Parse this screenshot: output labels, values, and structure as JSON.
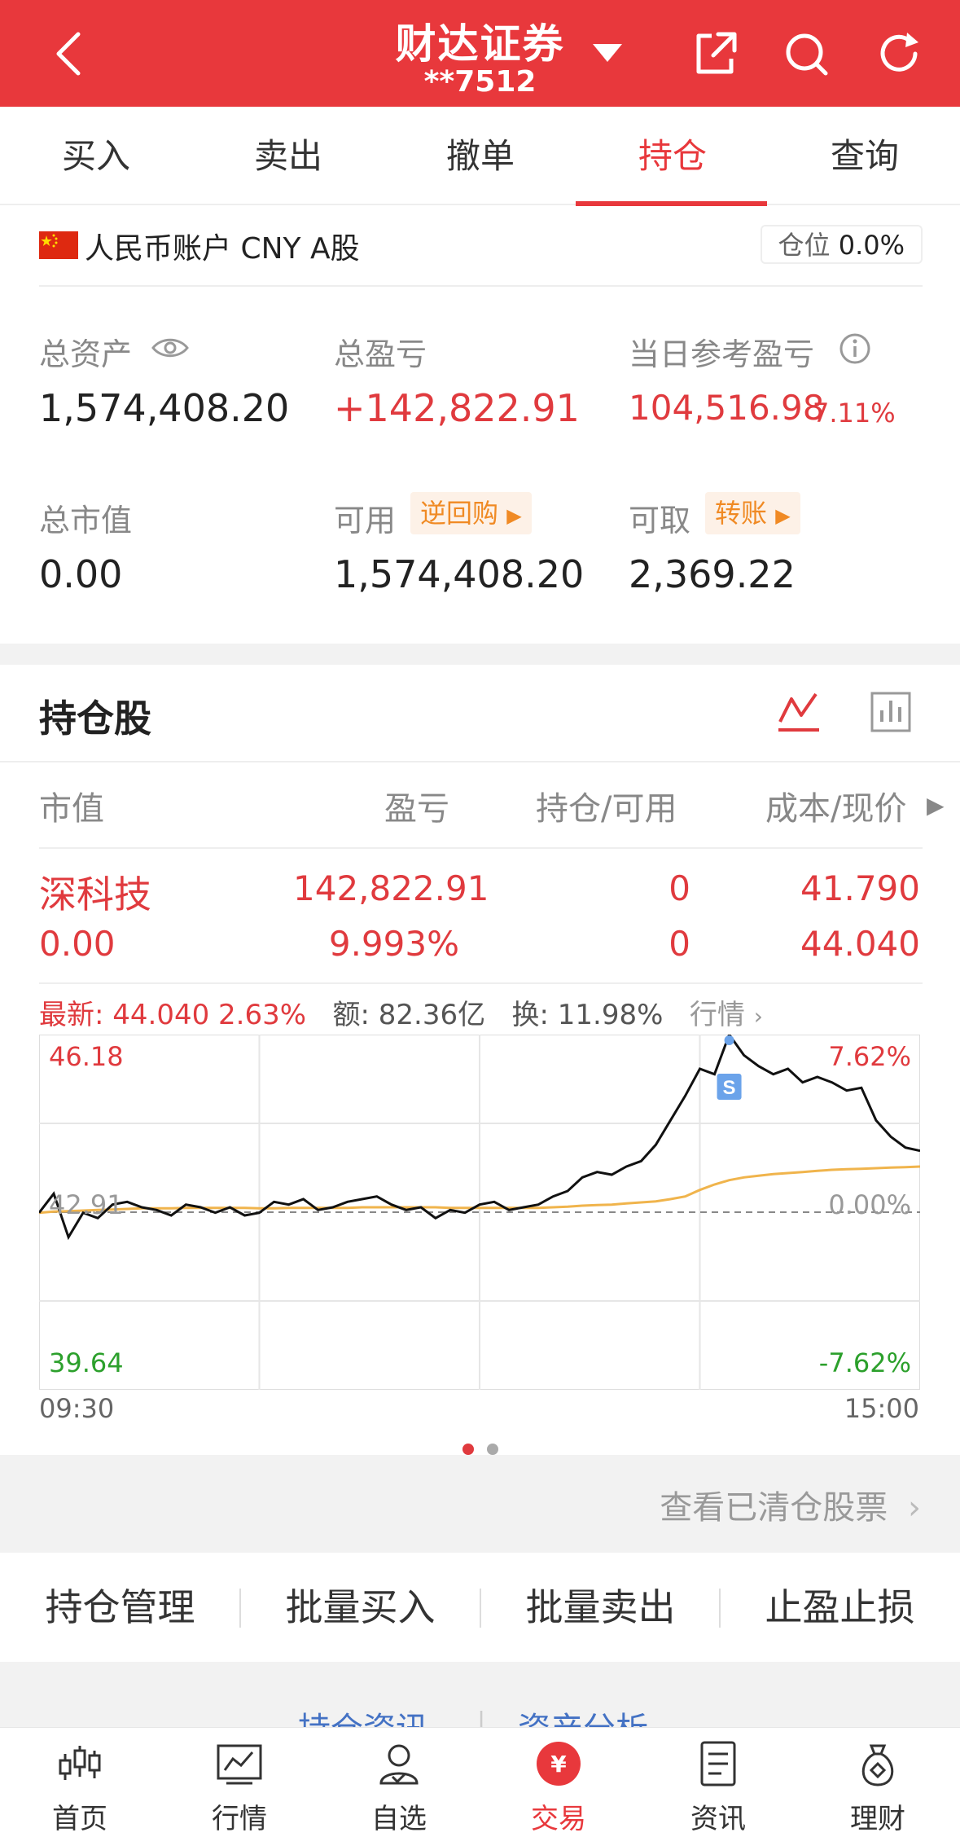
{
  "header": {
    "title": "财达证券",
    "account": "**7512"
  },
  "tabs": [
    "买入",
    "卖出",
    "撤单",
    "持仓",
    "查询"
  ],
  "account_row": {
    "label": "人民币账户 CNY A股",
    "position_label": "仓位",
    "position_value": "0.0%"
  },
  "summary": {
    "total_assets_label": "总资产",
    "total_assets": "1,574,408.20",
    "total_pnl_label": "总盈亏",
    "total_pnl": "+142,822.91",
    "daily_pnl_label": "当日参考盈亏",
    "daily_pnl": "104,516.98",
    "daily_pnl_pct": "7.11%",
    "market_value_label": "总市值",
    "market_value": "0.00",
    "available_label": "可用",
    "available_tag": "逆回购",
    "available": "1,574,408.20",
    "withdrawable_label": "可取",
    "withdrawable_tag": "转账",
    "withdrawable": "2,369.22"
  },
  "holdings": {
    "title": "持仓股",
    "columns": [
      "市值",
      "盈亏",
      "持仓/可用",
      "成本/现价"
    ],
    "rows": [
      {
        "name": "深科技",
        "market_value": "0.00",
        "pnl": "142,822.91",
        "pnl_pct": "9.993%",
        "position": "0",
        "available": "0",
        "cost": "41.790",
        "price": "44.040"
      }
    ],
    "quote": {
      "latest": "最新: 44.040 2.63%",
      "amount": "额: 82.36亿",
      "turnover": "换: 11.98%",
      "link": "行情"
    }
  },
  "chart_data": {
    "type": "line",
    "y_top": "46.18",
    "y_mid": "42.91",
    "y_bottom": "39.64",
    "pct_top": "7.62%",
    "pct_mid": "0.00%",
    "pct_bottom": "-7.62%",
    "x_start": "09:30",
    "x_end": "15:00",
    "marker": "S",
    "ylim": [
      39.64,
      46.18
    ],
    "series": [
      {
        "values": [
          42.9,
          43.25,
          42.45,
          42.9,
          42.8,
          43.05,
          43.1,
          43.0,
          42.95,
          42.85,
          43.05,
          43.0,
          42.9,
          43.0,
          42.85,
          42.9,
          43.1,
          43.05,
          43.15,
          42.95,
          43.0,
          43.1,
          43.15,
          43.2,
          43.05,
          42.95,
          43.0,
          42.8,
          42.95,
          42.9,
          43.05,
          43.1,
          42.95,
          43.0,
          43.05,
          43.2,
          43.3,
          43.55,
          43.65,
          43.6,
          43.75,
          43.85,
          44.15,
          44.6,
          45.05,
          45.55,
          45.45,
          46.18,
          45.8,
          45.6,
          45.45,
          45.55,
          45.3,
          45.4,
          45.3,
          45.15,
          45.2,
          44.6,
          44.3,
          44.1,
          44.04
        ]
      },
      {
        "values": [
          42.9,
          42.92,
          42.93,
          42.94,
          42.95,
          42.96,
          42.97,
          42.98,
          42.98,
          42.98,
          42.99,
          42.99,
          42.99,
          42.99,
          42.99,
          42.98,
          42.98,
          42.99,
          42.99,
          42.99,
          42.99,
          42.99,
          43.0,
          43.0,
          43.0,
          43.0,
          43.0,
          43.0,
          42.99,
          42.99,
          42.99,
          42.99,
          42.99,
          42.99,
          42.99,
          43.0,
          43.01,
          43.03,
          43.04,
          43.05,
          43.07,
          43.09,
          43.11,
          43.15,
          43.2,
          43.32,
          43.42,
          43.5,
          43.55,
          43.58,
          43.61,
          43.63,
          43.65,
          43.67,
          43.69,
          43.7,
          43.71,
          43.72,
          43.73,
          43.74,
          43.75
        ]
      }
    ],
    "colors": {
      "price": "#111111",
      "avg": "#f0b44c"
    }
  },
  "cleared_link": "查看已清仓股票",
  "actions": [
    "持仓管理",
    "批量买入",
    "批量卖出",
    "止盈止损"
  ],
  "bottom_links": [
    "持仓资讯",
    "资产分析"
  ],
  "nav": [
    {
      "label": "首页",
      "icon": "candlestick-icon"
    },
    {
      "label": "行情",
      "icon": "chart-icon"
    },
    {
      "label": "自选",
      "icon": "person-icon"
    },
    {
      "label": "交易",
      "icon": "yuan-icon"
    },
    {
      "label": "资讯",
      "icon": "document-icon"
    },
    {
      "label": "理财",
      "icon": "moneybag-icon"
    }
  ],
  "colors": {
    "brand": "#e8383c",
    "gain": "#e03a3e",
    "loss": "#2ca02c",
    "accent": "#f08a24"
  }
}
